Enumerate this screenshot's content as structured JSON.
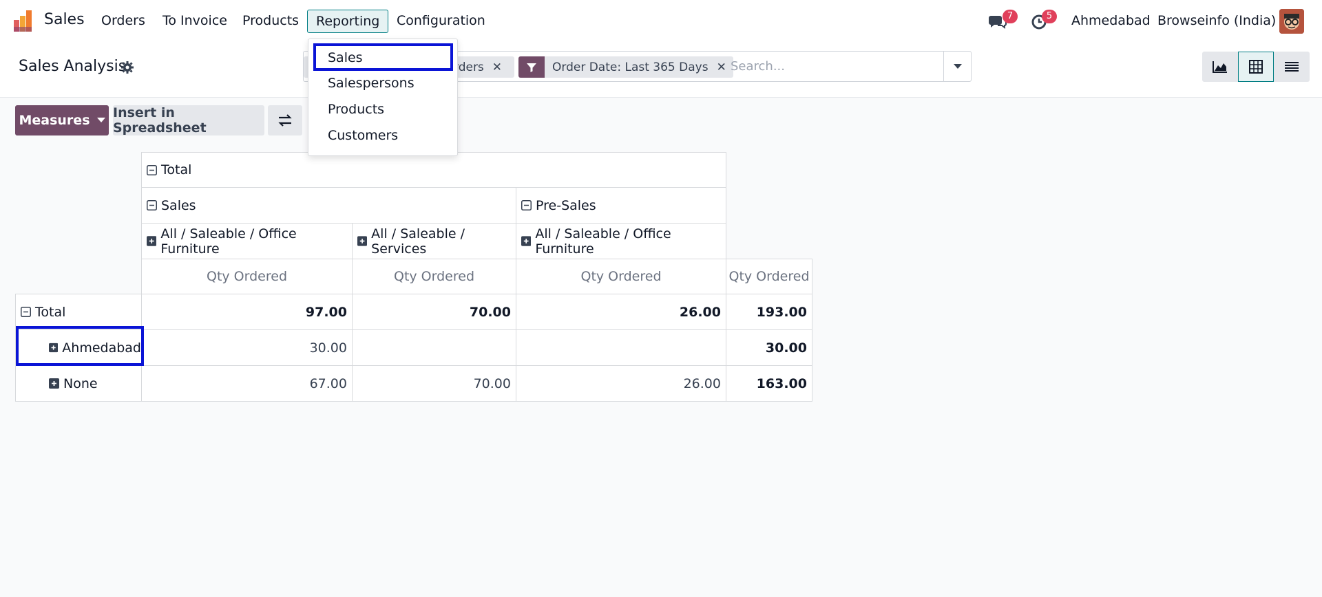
{
  "navbar": {
    "app_name": "Sales",
    "menu": [
      "Orders",
      "To Invoice",
      "Products",
      "Reporting",
      "Configuration"
    ],
    "messages_count": "7",
    "activities_count": "5",
    "company_city": "Ahmedabad",
    "company_name": "Browseinfo (India)"
  },
  "reporting_menu": {
    "items": [
      "Sales",
      "Salespersons",
      "Products",
      "Customers"
    ]
  },
  "control_panel": {
    "title": "Sales Analysis",
    "facets": [
      "rders",
      "Order Date: Last 365 Days"
    ],
    "search_placeholder": "Search..."
  },
  "buttons": {
    "measures": "Measures",
    "insert_spreadsheet": "Insert in Spreadsheet"
  },
  "pivot": {
    "col_total": "Total",
    "col_groups": [
      "Sales",
      "Pre-Sales"
    ],
    "col_sub": [
      "All / Saleable / Office Furniture",
      "All / Saleable / Services",
      "All / Saleable / Office Furniture"
    ],
    "measure": "Qty Ordered",
    "rows": [
      {
        "label": "Total",
        "values": [
          "97.00",
          "70.00",
          "26.00",
          "193.00"
        ]
      },
      {
        "label": "Ahmedabad",
        "values": [
          "30.00",
          "",
          "",
          "30.00"
        ]
      },
      {
        "label": "None",
        "values": [
          "67.00",
          "70.00",
          "26.00",
          "163.00"
        ]
      }
    ]
  },
  "colors": {
    "brand": "#714b67",
    "accent": "#017e84",
    "highlight": "#0a14d6",
    "badge": "#e0405b"
  }
}
